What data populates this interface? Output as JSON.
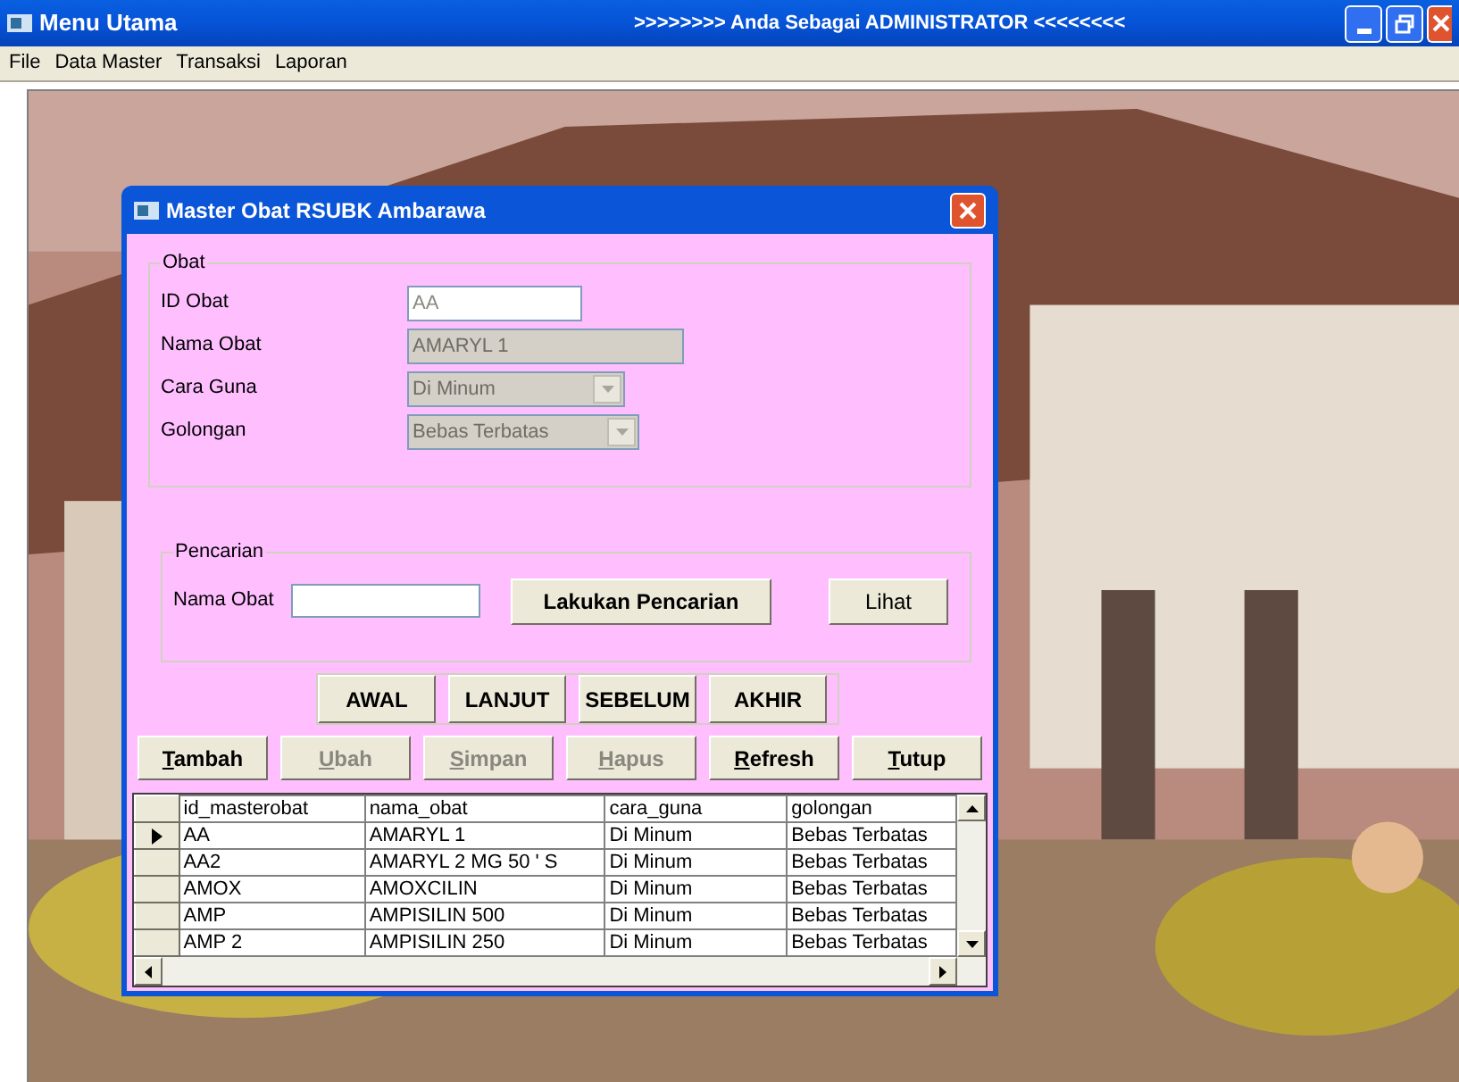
{
  "window": {
    "title": "Menu Utama",
    "status_title": ">>>>>>>> Anda Sebagai ADMINISTRATOR <<<<<<<<"
  },
  "menu": [
    "File",
    "Data Master",
    "Transaksi",
    "Laporan"
  ],
  "background": {
    "kind": "picture"
  },
  "dialog": {
    "title": "Master Obat RSUBK Ambarawa",
    "obat_group": {
      "title": "Obat",
      "fields": [
        {
          "kind": "text",
          "label": "ID Obat",
          "value": "AA",
          "disabled": false
        },
        {
          "kind": "text",
          "label": "Nama Obat",
          "value": "AMARYL 1",
          "disabled": true
        },
        {
          "kind": "combo",
          "label": "Cara Guna",
          "value": "Di Minum",
          "disabled": true
        },
        {
          "kind": "combo",
          "label": "Golongan",
          "value": "Bebas Terbatas",
          "disabled": true
        }
      ]
    },
    "search_group": {
      "title": "Pencarian",
      "label": "Nama Obat",
      "search_button": "Lakukan Pencarian",
      "view_button": "Lihat"
    },
    "nav_buttons": [
      "AWAL",
      "LANJUT",
      "SEBELUM",
      "AKHIR"
    ],
    "action_buttons": [
      {
        "label": "Tambah",
        "disabled": false
      },
      {
        "label": "Ubah",
        "disabled": true
      },
      {
        "label": "Simpan",
        "disabled": true
      },
      {
        "label": "Hapus",
        "disabled": true
      },
      {
        "label": "Refresh",
        "disabled": false
      },
      {
        "label": "Tutup",
        "disabled": false
      }
    ],
    "table": {
      "columns": [
        "id_masterobat",
        "nama_obat",
        "cara_guna",
        "golongan"
      ],
      "rows": [
        {
          "cells": [
            "AA",
            "AMARYL 1",
            "Di Minum",
            "Bebas Terbatas"
          ],
          "selected": true
        },
        {
          "cells": [
            "AA2",
            "AMARYL 2 MG 50 ' S",
            "Di Minum",
            "Bebas Terbatas"
          ],
          "selected": false
        },
        {
          "cells": [
            "AMOX",
            "AMOXCILIN",
            "Di Minum",
            "Bebas Terbatas"
          ],
          "selected": false
        },
        {
          "cells": [
            "AMP",
            "AMPISILIN 500",
            "Di Minum",
            "Bebas Terbatas"
          ],
          "selected": false
        },
        {
          "cells": [
            "AMP 2",
            "AMPISILIN 250",
            "Di Minum",
            "Bebas Terbatas"
          ],
          "selected": false
        }
      ]
    }
  }
}
